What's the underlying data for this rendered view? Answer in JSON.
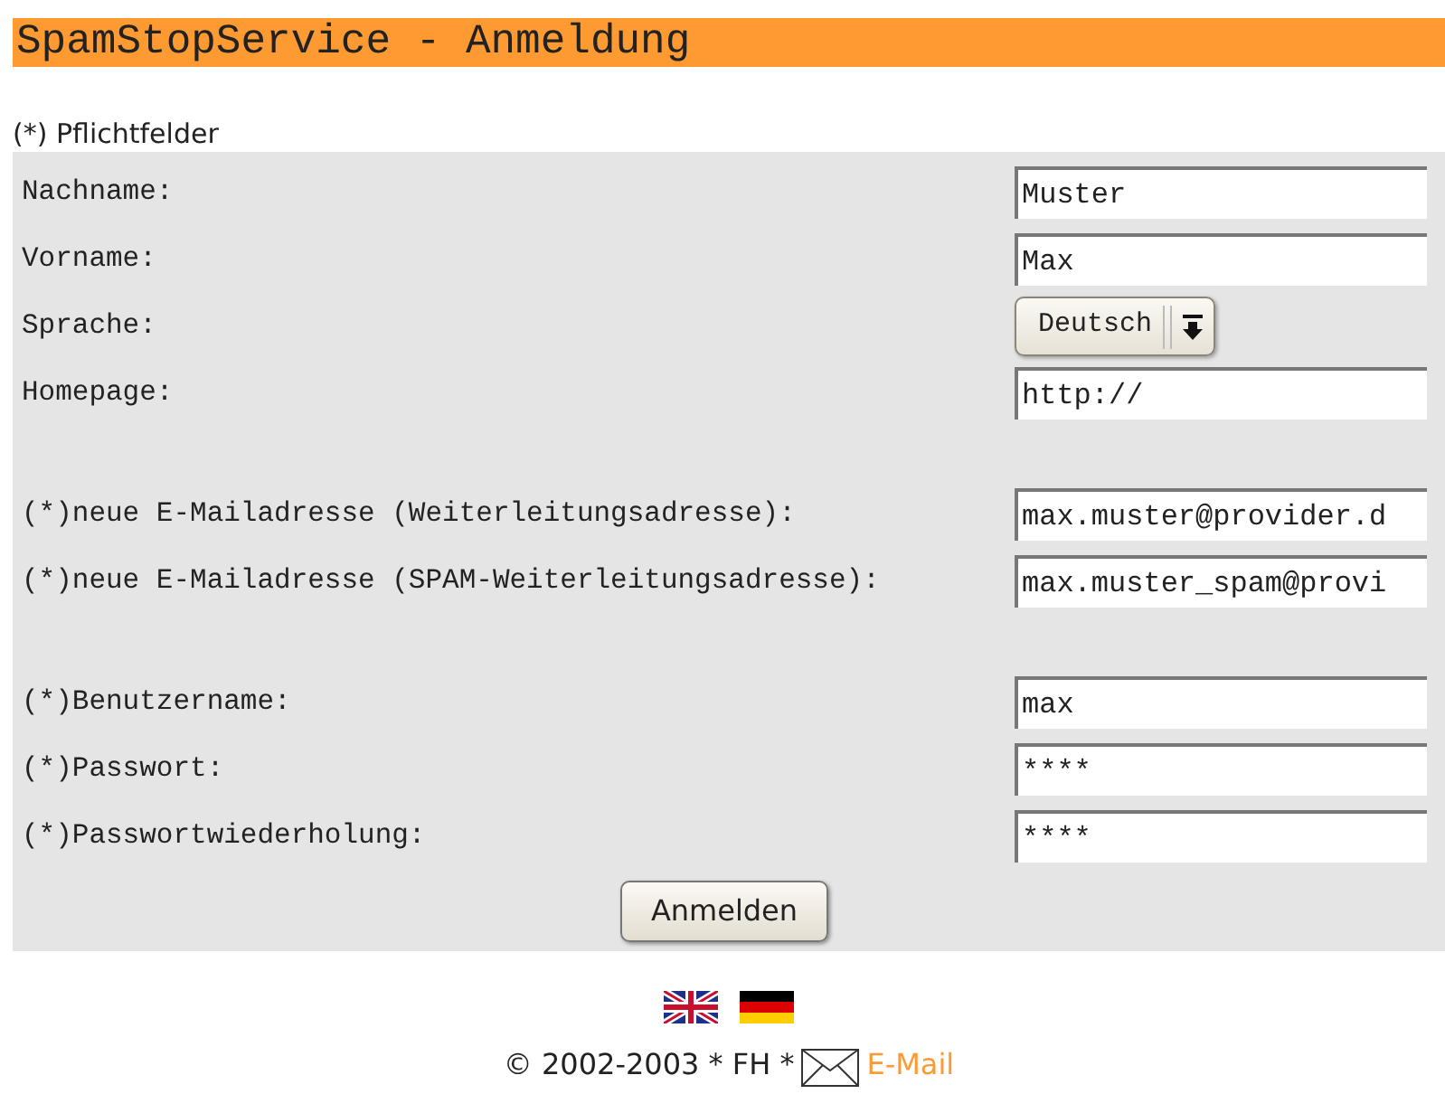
{
  "title": "SpamStopService - Anmeldung",
  "required_note": "(*) Pflichtfelder",
  "groups": [
    [
      {
        "kind": "text",
        "label": "Nachname:",
        "value": "Muster"
      },
      {
        "kind": "text",
        "label": "Vorname:",
        "value": "Max"
      },
      {
        "kind": "select",
        "label": "Sprache:",
        "value": "Deutsch"
      },
      {
        "kind": "text",
        "label": "Homepage:",
        "value": "http://"
      }
    ],
    [
      {
        "kind": "text",
        "label": "(*)neue E-Mailadresse (Weiterleitungsadresse):",
        "value": "max.muster@provider.d"
      },
      {
        "kind": "text",
        "label": "(*)neue E-Mailadresse (SPAM-Weiterleitungsadresse):",
        "value": "max.muster_spam@provi"
      }
    ],
    [
      {
        "kind": "text",
        "label": "(*)Benutzername:",
        "value": "max"
      },
      {
        "kind": "text",
        "label": "(*)Passwort:",
        "value": "****"
      },
      {
        "kind": "text",
        "label": "(*)Passwortwiederholung:",
        "value": "****"
      }
    ]
  ],
  "submit": "Anmelden",
  "footer": {
    "copyright": "© 2002-2003 * FH *",
    "email_link": "E-Mail"
  }
}
